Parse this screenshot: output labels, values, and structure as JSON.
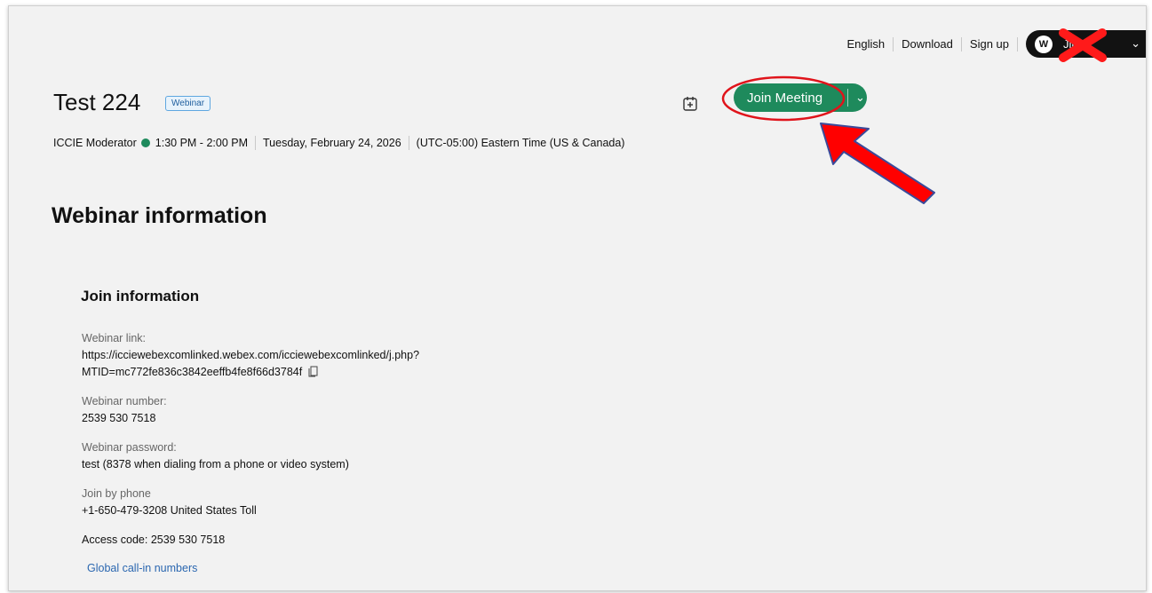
{
  "header": {
    "language": "English",
    "download": "Download",
    "signup": "Sign up",
    "user_logo": "W",
    "user_name": "Jin"
  },
  "meeting": {
    "title": "Test 224",
    "badge": "Webinar",
    "join_label": "Join Meeting",
    "host": "ICCIE Moderator",
    "time": "1:30 PM - 2:00 PM",
    "date": "Tuesday, February 24, 2026",
    "timezone": "(UTC-05:00) Eastern Time (US & Canada)"
  },
  "info": {
    "section_title": "Webinar information",
    "join_title": "Join information",
    "link_label": "Webinar link:",
    "link_line1": "https://icciewebexcomlinked.webex.com/icciewebexcomlinked/j.php?",
    "link_line2": "MTID=mc772fe836c3842eeffb4fe8f66d3784f",
    "number_label": "Webinar number:",
    "number": "2539 530 7518",
    "password_label": "Webinar password:",
    "password": "test (8378 when dialing from a phone or video system)",
    "phone_label": "Join by phone",
    "phone": "+1-650-479-3208 United States Toll",
    "access_code": "Access code: 2539 530 7518",
    "global_link": "Global call-in numbers"
  },
  "colors": {
    "join_green": "#1e8a5c",
    "annotation_red": "#ff0000",
    "annotation_outline": "#3a4a9a"
  }
}
